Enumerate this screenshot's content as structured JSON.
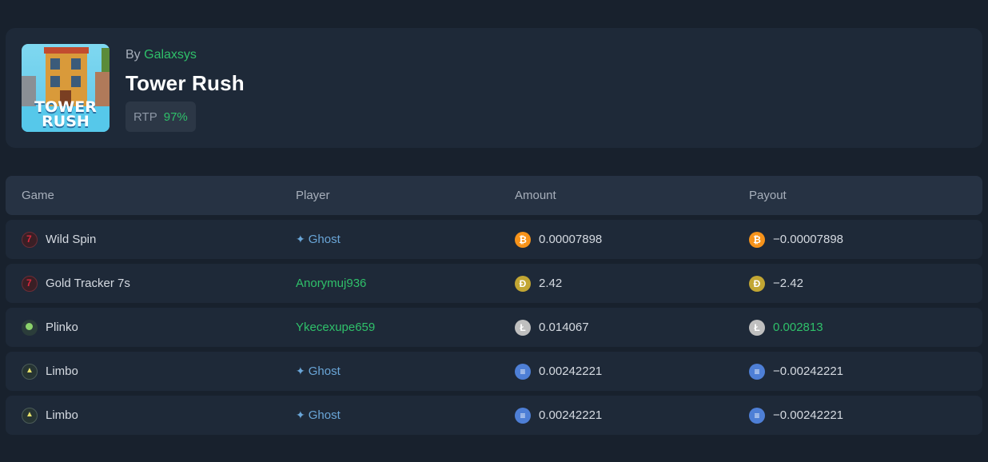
{
  "game": {
    "by_label": "By",
    "studio": "Galaxsys",
    "title": "Tower Rush",
    "thumbnail_text_1": "TOWER",
    "thumbnail_text_2": "RUSH",
    "rtp_label": "RTP",
    "rtp_value": "97%"
  },
  "table": {
    "headers": {
      "game": "Game",
      "player": "Player",
      "amount": "Amount",
      "payout": "Payout"
    },
    "rows": [
      {
        "game": "Wild Spin",
        "game_icon": "slots-icon",
        "player": "Ghost",
        "hidden": true,
        "coin": "bitcoin-icon",
        "amount": "0.00007898",
        "payout": "−0.00007898"
      },
      {
        "game": "Gold Tracker 7s",
        "game_icon": "slots-icon",
        "player": "Anorymuj936",
        "hidden": false,
        "coin": "dogecoin-icon",
        "amount": "2.42",
        "payout": "−2.42"
      },
      {
        "game": "Plinko",
        "game_icon": "plinko-icon",
        "player": "Ykecexupe659",
        "hidden": false,
        "coin": "litecoin-icon",
        "amount": "0.014067",
        "payout": "0.002813"
      },
      {
        "game": "Limbo",
        "game_icon": "limbo-icon",
        "player": "Ghost",
        "hidden": true,
        "coin": "solana-icon",
        "amount": "0.00242221",
        "payout": "−0.00242221"
      },
      {
        "game": "Limbo",
        "game_icon": "limbo-icon",
        "player": "Ghost",
        "hidden": true,
        "coin": "solana-icon",
        "amount": "0.00242221",
        "payout": "−0.00242221"
      }
    ]
  },
  "colors": {
    "accent_green": "#2fc06a",
    "background": "#18212d",
    "card": "#1e2938"
  }
}
